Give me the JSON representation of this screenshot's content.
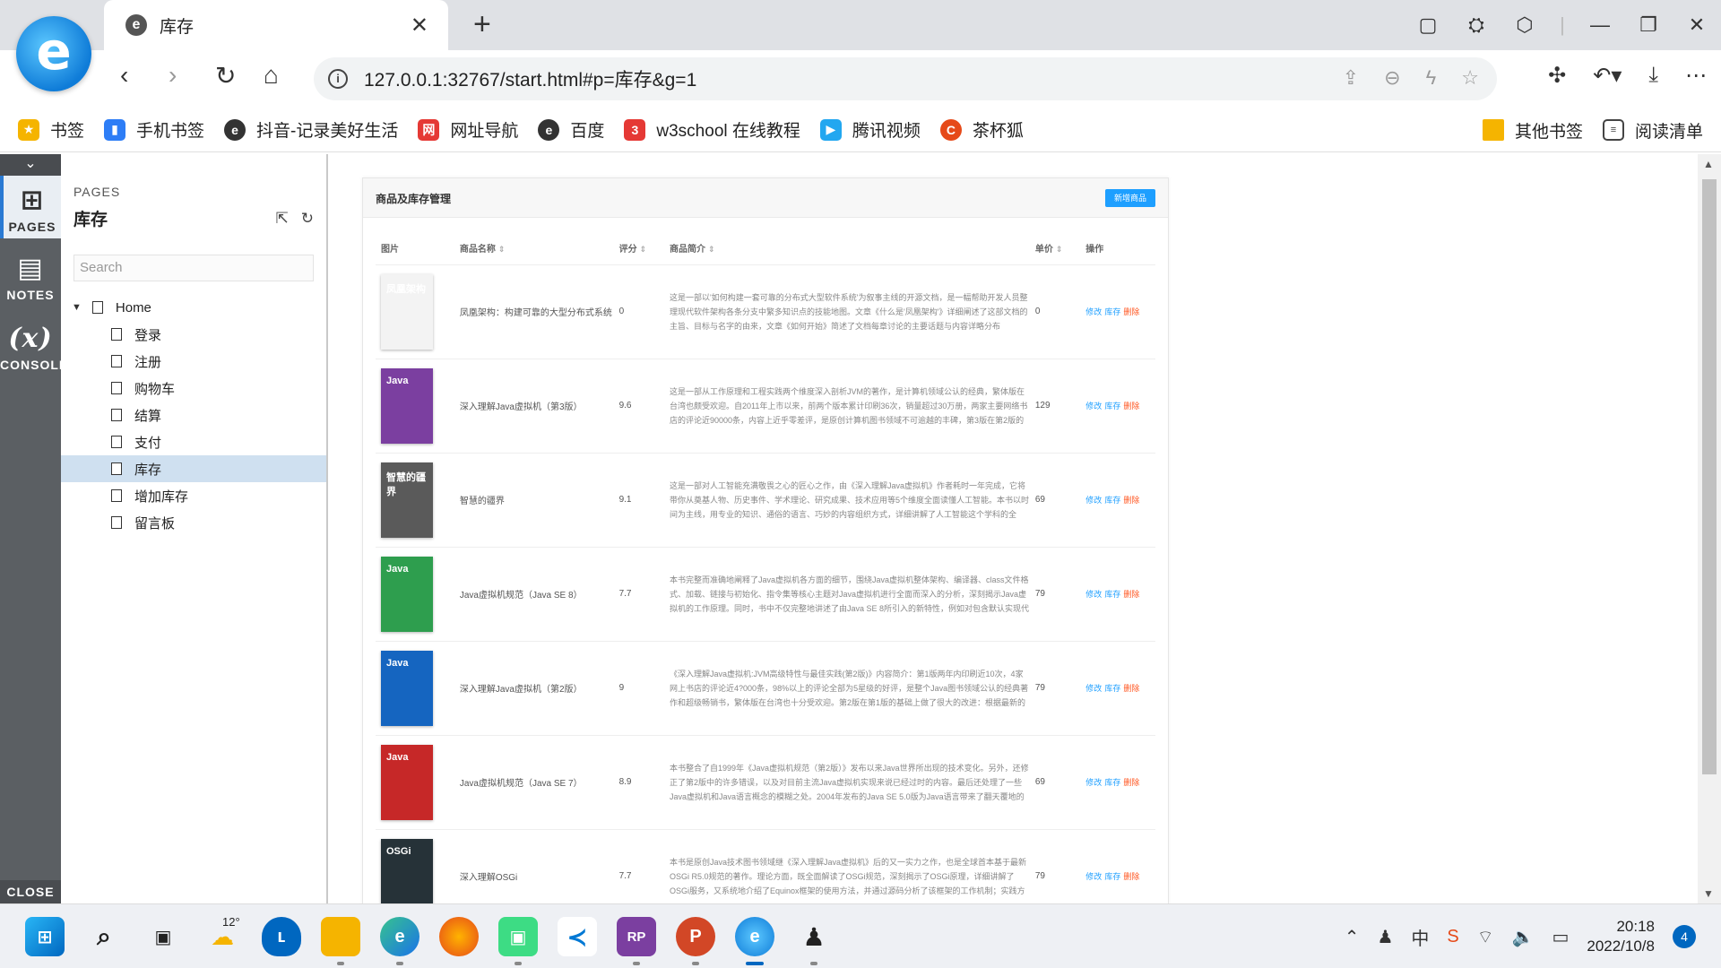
{
  "browser": {
    "tab_title": "库存",
    "url": "127.0.0.1:32767/start.html#p=库存&g=1",
    "bookmarks": [
      {
        "label": "书签",
        "color": "#f5b400",
        "icon": "star-icon"
      },
      {
        "label": "手机书签",
        "color": "#2d7df6",
        "icon": "phone-bookmark-icon"
      },
      {
        "label": "抖音-记录美好生活",
        "color": "#333333",
        "icon": "douyin-icon"
      },
      {
        "label": "网址导航",
        "color": "#e53935",
        "icon": "nav-icon"
      },
      {
        "label": "百度",
        "color": "#333333",
        "icon": "baidu-icon"
      },
      {
        "label": "w3school 在线教程",
        "color": "#e53935",
        "icon": "w3school-icon"
      },
      {
        "label": "腾讯视频",
        "color": "#22a7f0",
        "icon": "tencent-video-icon"
      },
      {
        "label": "茶杯狐",
        "color": "#e64a19",
        "icon": "chabeihu-icon"
      }
    ],
    "bookmarks_right": [
      {
        "label": "其他书签",
        "icon": "folder-icon"
      },
      {
        "label": "阅读清单",
        "icon": "reading-list-icon"
      }
    ]
  },
  "rail": {
    "pages": "PAGES",
    "notes": "NOTES",
    "console": "CONSOLE",
    "close": "CLOSE"
  },
  "pages_panel": {
    "heading": "PAGES",
    "current": "库存",
    "search_placeholder": "Search",
    "home": "Home",
    "children": [
      "登录",
      "注册",
      "购物车",
      "结算",
      "支付",
      "库存",
      "增加库存",
      "留言板"
    ],
    "selected": "库存"
  },
  "inventory": {
    "title": "商品及库存管理",
    "add_button": "新增商品",
    "columns": [
      "图片",
      "商品名称",
      "评分",
      "商品简介",
      "单价",
      "操作"
    ],
    "actions": {
      "edit": "修改",
      "stock": "库存",
      "delete": "删除"
    },
    "rows": [
      {
        "name": "凤凰架构：构建可靠的大型分布式系统",
        "rating": "0",
        "price": "0",
        "desc": "这是一部以'如何构建一套可靠的分布式大型软件系统'为叙事主线的开源文档，是一幅帮助开发人员整理现代软件架构各条分支中繁多知识点的技能地图。文章《什么是'凤凰架构'》详细阐述了这部文档的主旨、目标与名字的由来，文章《如何开始》简述了文档每章讨论的主要话题与内容详略分布",
        "cover_color": "#f3f3f3",
        "cover_text": "凤凰架构"
      },
      {
        "name": "深入理解Java虚拟机（第3版）",
        "rating": "9.6",
        "price": "129",
        "desc": "这是一部从工作原理和工程实践两个维度深入剖析JVM的著作，是计算机领域公认的经典，繁体版在台湾也颇受欢迎。自2011年上市以来，前两个版本累计印刷36次，销量超过30万册，两家主要网络书店的评论近90000条，内容上近乎零差评，是原创计算机图书领域不可逾越的丰碑，第3版在第2版的基础上做了…",
        "cover_color": "#7b3fa0",
        "cover_text": "Java"
      },
      {
        "name": "智慧的疆界",
        "rating": "9.1",
        "price": "69",
        "desc": "这是一部对人工智能充满敬畏之心的匠心之作，由《深入理解Java虚拟机》作者耗时一年完成，它将带你从奠基人物、历史事件、学术理论、研究成果、技术应用等5个维度全面读懂人工智能。本书以时间为主线，用专业的知识、通俗的语言、巧妙的内容组织方式，详细讲解了人工智能这个学科的全貌、能解决…",
        "cover_color": "#5a5a5a",
        "cover_text": "智慧的疆界"
      },
      {
        "name": "Java虚拟机规范（Java SE 8）",
        "rating": "7.7",
        "price": "79",
        "desc": "本书完整而准确地阐释了Java虚拟机各方面的细节，围绕Java虚拟机整体架构、编译器、class文件格式、加载、链接与初始化、指令集等核心主题对Java虚拟机进行全面而深入的分析，深刻揭示Java虚拟机的工作原理。同时，书中不仅完整地讲述了由Java SE 8所引入的新特性，例如对包含默认实现代码的接口方…",
        "cover_color": "#2e9e4e",
        "cover_text": "Java"
      },
      {
        "name": "深入理解Java虚拟机（第2版）",
        "rating": "9",
        "price": "79",
        "desc": "《深入理解Java虚拟机:JVM高级特性与最佳实践(第2版)》内容简介：第1版两年内印刷近10次，4家网上书店的评论近4?000条，98%以上的评论全部为5星级的好评，是整个Java图书领域公认的经典著作和超级畅销书，繁体版在台湾也十分受欢迎。第2版在第1版的基础上做了很大的改进：根据最新的JDK 1.7对…",
        "cover_color": "#1565c0",
        "cover_text": "Java"
      },
      {
        "name": "Java虚拟机规范（Java SE 7）",
        "rating": "8.9",
        "price": "69",
        "desc": "本书整合了自1999年《Java虚拟机规范（第2版）》发布以来Java世界所出现的技术变化。另外，还修正了第2版中的许多错误，以及对目前主流Java虚拟机实现来说已经过时的内容。最后还处理了一些Java虚拟机和Java语言概念的模糊之处。2004年发布的Java SE 5.0版为Java语言带来了翻天覆地的变化，但…",
        "cover_color": "#c62828",
        "cover_text": "Java"
      },
      {
        "name": "深入理解OSGi",
        "rating": "7.7",
        "price": "79",
        "desc": "本书是原创Java技术图书领域继《深入理解Java虚拟机》后的又一实力之作，也是全球首本基于最新OSGi R5.0规范的著作。理论方面，既全面解读了OSGi规范，深刻揭示了OSGi原理，详细讲解了OSGi服务，又系统地介绍了Equinox框架的使用方法，并通过源码分析了该框架的工作机制；实践方面，不仅包含一…",
        "cover_color": "#263238",
        "cover_text": "OSGi"
      }
    ]
  },
  "taskbar": {
    "weather_temp": "12°",
    "time": "20:18",
    "date": "2022/10/8",
    "notifications": "4",
    "ime": "中"
  }
}
